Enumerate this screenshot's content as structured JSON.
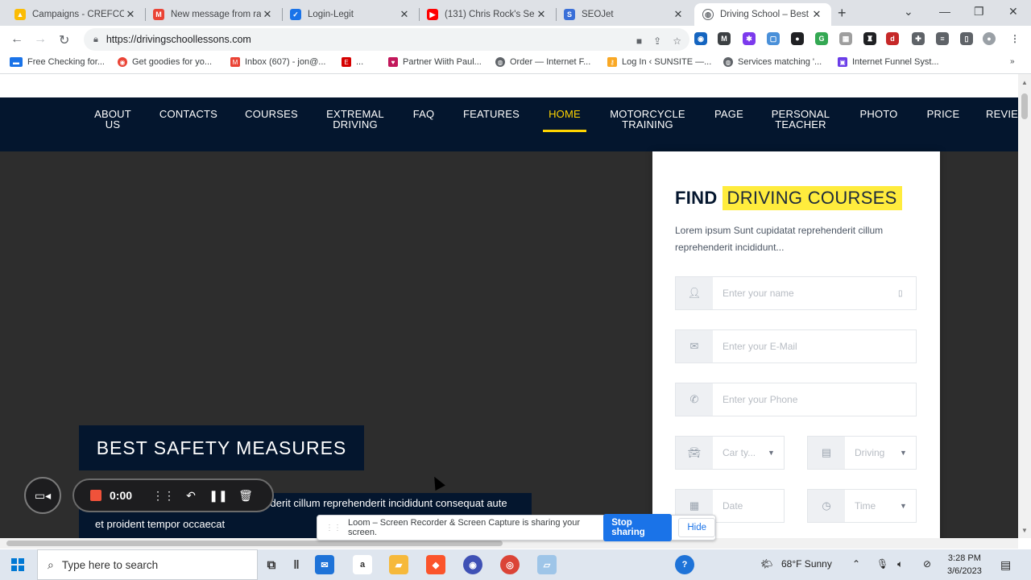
{
  "browser": {
    "tabs": [
      {
        "label": "Campaigns - CREFCO",
        "icon": "google-ads-icon",
        "color": "#fbbc04"
      },
      {
        "label": "New message from ra",
        "icon": "gmail-icon",
        "color": "#ea4335"
      },
      {
        "label": "Login-Legit",
        "icon": "check-icon",
        "color": "#1a73e8"
      },
      {
        "label": "(131) Chris Rock's Sel",
        "icon": "youtube-icon",
        "color": "#ff0000"
      },
      {
        "label": "SEOJet",
        "icon": "seojet-icon",
        "color": "#3a6fd8"
      },
      {
        "label": "Driving School – Best",
        "icon": "globe-icon",
        "color": "#5f6368"
      }
    ],
    "url": "https://drivingschoollessons.com",
    "bookmarks": [
      {
        "label": "Free Checking for...",
        "color": "#1a73e8"
      },
      {
        "label": "Get goodies for yo...",
        "color": "#ea4335"
      },
      {
        "label": "Inbox (607) - jon@...",
        "color": "#ea4335"
      },
      {
        "label": "...",
        "color": "#d50000"
      },
      {
        "label": "Partner Wiith Paul...",
        "color": "#c2185b"
      },
      {
        "label": "Order — Internet F...",
        "color": "#5f6368"
      },
      {
        "label": "Log In ‹ SUNSITE —...",
        "color": "#f9a825"
      },
      {
        "label": "Services matching '...",
        "color": "#5f6368"
      },
      {
        "label": "Internet Funnel Syst...",
        "color": "#6a3de8"
      }
    ]
  },
  "site": {
    "nav": [
      {
        "label": "ABOUT US"
      },
      {
        "label": "CONTACTS"
      },
      {
        "label": "COURSES"
      },
      {
        "label": "EXTREMAL DRIVING"
      },
      {
        "label": "FAQ"
      },
      {
        "label": "FEATURES"
      },
      {
        "label": "HOME",
        "active": true
      },
      {
        "label": "MOTORCYCLE TRAINING"
      },
      {
        "label": "PAGE"
      },
      {
        "label": "PERSONAL TEACHER"
      },
      {
        "label": "PHOTO"
      },
      {
        "label": "PRICE"
      },
      {
        "label": "REVIE"
      }
    ],
    "hero": {
      "title": "BEST SAFETY MEASURES",
      "text": "Lorem ipsum Sunt cupidatat reprehenderit cillum reprehenderit incididunt consequat aute et proident tempor occaecat"
    },
    "form": {
      "heading_plain": "FIND",
      "heading_highlight": "DRIVING COURSES",
      "description": "Lorem ipsum Sunt cupidatat reprehenderit cillum reprehenderit incididunt...",
      "name_placeholder": "Enter your name",
      "email_placeholder": "Enter your E-Mail",
      "phone_placeholder": "Enter your Phone",
      "car_type_placeholder": "Car ty...",
      "driving_placeholder": "Driving",
      "date_placeholder": "Date",
      "time_placeholder": "Time"
    }
  },
  "loom": {
    "timer": "0:00",
    "share_message": "Loom – Screen Recorder & Screen Capture is sharing your screen.",
    "stop_label": "Stop sharing",
    "hide_label": "Hide"
  },
  "taskbar": {
    "search_placeholder": "Type here to search",
    "weather": "68°F  Sunny",
    "time": "3:28 PM",
    "date": "3/6/2023"
  }
}
